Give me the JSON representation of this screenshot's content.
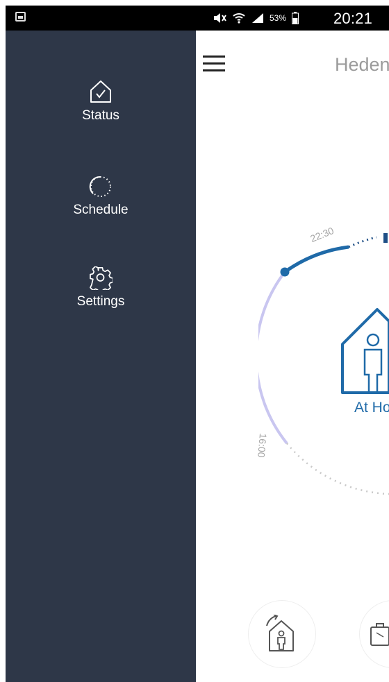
{
  "statusbar": {
    "battery": "53%",
    "time": "20:21"
  },
  "drawer": {
    "items": [
      {
        "label": "Status",
        "icon": "home-check-icon"
      },
      {
        "label": "Schedule",
        "icon": "dotted-circle-icon"
      },
      {
        "label": "Settings",
        "icon": "gear-icon"
      }
    ]
  },
  "header": {
    "title": "Heden"
  },
  "dial": {
    "time_top": "22:30",
    "time_left": "16:00",
    "mode_label": "At Ho"
  },
  "colors": {
    "drawer_bg": "#2e3748",
    "accent": "#1f6aa8",
    "arc_light": "#c9c6f0"
  }
}
